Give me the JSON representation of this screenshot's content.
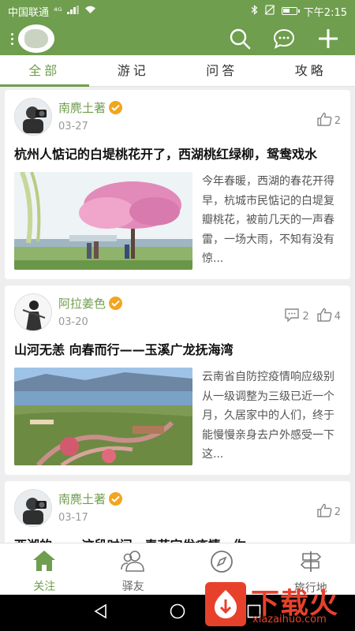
{
  "status": {
    "carrier": "中国联通",
    "signal": "⁴ᴳ",
    "time": "下午2:15",
    "battery_level": 0.55
  },
  "header": {
    "icons": [
      "search-icon",
      "chat-icon",
      "plus-icon"
    ]
  },
  "tabs": [
    {
      "label": "全部",
      "active": true
    },
    {
      "label": "游记",
      "active": false
    },
    {
      "label": "问答",
      "active": false
    },
    {
      "label": "攻略",
      "active": false
    }
  ],
  "posts": [
    {
      "author": "南麂土著",
      "date": "03-27",
      "likes": "2",
      "comments": "",
      "title": "杭州人惦记的白堤桃花开了，西湖桃红绿柳，鸳鸯戏水",
      "excerpt": "今年春暖，西湖的春花开得早，杭城市民惦记的白堤复瓣桃花，被前几天的一声春雷，一场大雨，不知有没有惊..."
    },
    {
      "author": "阿拉姜色",
      "date": "03-20",
      "likes": "4",
      "comments": "2",
      "title": "山河无恙 向春而行——玉溪广龙抚海湾",
      "excerpt": "云南省自防控疫情响应级别从一级调整为三级已近一个月，久居家中的人们，终于能慢慢亲身去户外感受一下这..."
    },
    {
      "author": "南麂土著",
      "date": "03-17",
      "likes": "2",
      "comments": "",
      "title": "西湖的…… 这段时间，春花完发疫情，你",
      "excerpt": ""
    }
  ],
  "bottom_nav": [
    {
      "label": "关注",
      "icon": "home-icon",
      "active": true
    },
    {
      "label": "驿友",
      "icon": "friends-icon",
      "active": false
    },
    {
      "label": "发现",
      "icon": "compass-icon",
      "active": false
    },
    {
      "label": "旅行地",
      "icon": "signpost-icon",
      "active": false
    }
  ],
  "watermark": {
    "text": "下载火",
    "url": "xiazaihuo.com"
  },
  "colors": {
    "brand": "#6f9e4e",
    "verified": "#f2a51d",
    "watermark": "#e7412b"
  }
}
